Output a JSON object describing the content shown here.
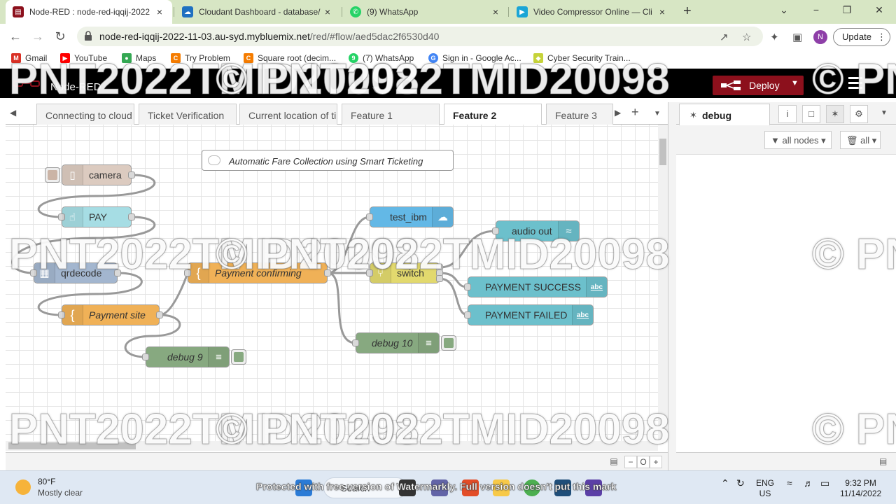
{
  "browser": {
    "tabs": [
      {
        "title": "Node-RED : node-red-iqqij-2022",
        "close": "×",
        "fav": "▤",
        "fav_color": "#8c101c"
      },
      {
        "title": "Cloudant Dashboard - database/",
        "close": "×",
        "fav": "☁",
        "fav_color": "#1f70c1"
      },
      {
        "title": "(9) WhatsApp",
        "close": "×",
        "fav": "✆",
        "fav_color": "#25d366"
      },
      {
        "title": "Video Compressor Online — Cli",
        "close": "×",
        "fav": "▶",
        "fav_color": "#1aa5d6"
      }
    ],
    "new_tab": "+",
    "window_controls": {
      "collapse": "⌄",
      "minimize": "−",
      "restore": "❐",
      "close": "✕"
    },
    "nav": {
      "back": "←",
      "forward": "→",
      "reload": "↻"
    },
    "url_host": "node-red-iqqij-2022-11-03.au-syd.mybluemix.net",
    "url_path": "/red/#flow/aed5dac2f6530d40",
    "omni_icons": {
      "share": "↗",
      "star": "☆",
      "extensions": "✦",
      "sidepanel": "▣",
      "menu": "⋮"
    },
    "profile_initial": "N",
    "update_label": "Update",
    "bookmarks": [
      {
        "label": "Gmail",
        "color": "#d93025",
        "icon": "M"
      },
      {
        "label": "YouTube",
        "color": "#ff0000",
        "icon": "▶"
      },
      {
        "label": "Maps",
        "color": "#34a853",
        "icon": "●"
      },
      {
        "label": "Try Problem",
        "color": "#f57c00",
        "icon": "C"
      },
      {
        "label": "Square root (decim...",
        "color": "#f57c00",
        "icon": "C"
      },
      {
        "label": "(7) WhatsApp",
        "color": "#25d366",
        "icon": "9"
      },
      {
        "label": "Sign in - Google Ac...",
        "color": "#4285f4",
        "icon": "G"
      },
      {
        "label": "Cyber Security Train...",
        "color": "#c6d33a",
        "icon": "◆"
      }
    ]
  },
  "nodered": {
    "title": "Node-RED",
    "deploy_label": "Deploy",
    "deploy_caret": "▼",
    "flow_tabs": [
      "Connecting to cloud",
      "Ticket Verification",
      "Current location of ti",
      "Feature 1",
      "Feature 2",
      "Feature 3"
    ],
    "active_flow_tab": "Feature 2",
    "tab_nav": {
      "left": "◀",
      "right": "▶",
      "add": "+",
      "menu": "▼"
    },
    "comment": "Automatic Fare Collection using Smart Ticketing",
    "nodes": {
      "camera": {
        "label": "camera",
        "color": "#dccbc0",
        "icon": "▯"
      },
      "pay": {
        "label": "PAY",
        "color": "#a6dde4",
        "icon": "☝"
      },
      "qrdecode": {
        "label": "qrdecode",
        "color": "#a3b6cf",
        "icon": "▦"
      },
      "payment_site": {
        "label": "Payment site",
        "color": "#f0b157",
        "icon": "{"
      },
      "debug9": {
        "label": "debug 9",
        "color": "#87a980",
        "icon": "≡"
      },
      "payment_confirming": {
        "label": "Payment confirming",
        "color": "#f0b157",
        "icon": "{"
      },
      "test_ibm": {
        "label": "test_ibm",
        "color": "#63b8e6",
        "icon": "☁"
      },
      "switch": {
        "label": "switch",
        "color": "#e2d96e",
        "icon": "⑂"
      },
      "audio_out": {
        "label": "audio out",
        "color": "#6cc0cc",
        "icon": "≈"
      },
      "payment_success": {
        "label": "PAYMENT SUCCESS",
        "color": "#6cc0cc",
        "icon": "abc"
      },
      "payment_failed": {
        "label": "PAYMENT FAILED",
        "color": "#6cc0cc",
        "icon": "abc"
      },
      "debug10": {
        "label": "debug 10",
        "color": "#87a980",
        "icon": "≡"
      }
    },
    "canvas_footer": {
      "map": "▤",
      "zoom_out": "−",
      "reset": "O",
      "zoom_in": "+"
    },
    "sidebar": {
      "active_tab": "debug",
      "tab_icons": {
        "info": "i",
        "help": "□",
        "debug": "✶",
        "config": "⚙",
        "menu": "▼"
      },
      "filter_nodes": "all nodes",
      "filter_clear": "all",
      "filter_caret": "▾"
    }
  },
  "watermark": "© PNT2022TMID20098",
  "taskbar": {
    "temp": "80°F",
    "condition": "Mostly clear",
    "search": "Search",
    "banner": "Protected with free version of Watermarkly. Full version doesn't put this mark",
    "lang_line1": "ENG",
    "lang_line2": "US",
    "time": "9:32 PM",
    "date": "11/14/2022"
  }
}
